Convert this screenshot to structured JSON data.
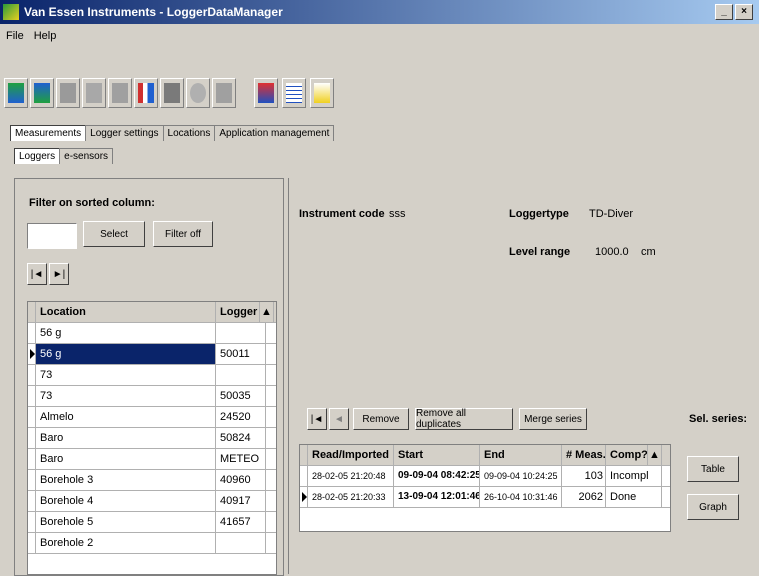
{
  "window": {
    "title": "Van Essen Instruments - LoggerDataManager",
    "min": "_",
    "close": "×"
  },
  "menu": [
    "File",
    "Help"
  ],
  "tabs": [
    "Measurements",
    "Logger settings",
    "Locations",
    "Application management"
  ],
  "subtabs": [
    "Loggers",
    "e-sensors"
  ],
  "filter": {
    "label": "Filter on sorted column:",
    "input_value": "",
    "select": "Select",
    "filter_off": "Filter off",
    "nav_first": "|◄",
    "nav_last": "►|"
  },
  "locations_table": {
    "headers": [
      "Location",
      "Logger"
    ],
    "rows": [
      {
        "location": "56 g",
        "logger": ""
      },
      {
        "location": "56 g",
        "logger": "50011"
      },
      {
        "location": "73",
        "logger": ""
      },
      {
        "location": "73",
        "logger": "50035"
      },
      {
        "location": "Almelo",
        "logger": "24520"
      },
      {
        "location": "Baro",
        "logger": "50824"
      },
      {
        "location": "Baro",
        "logger": "METEO"
      },
      {
        "location": "Borehole 3",
        "logger": "40960"
      },
      {
        "location": "Borehole 4",
        "logger": "40917"
      },
      {
        "location": "Borehole 5",
        "logger": "41657"
      },
      {
        "location": "Borehole 2",
        "logger": ""
      }
    ]
  },
  "info": {
    "instrument_code_label": "Instrument code",
    "instrument_code": "sss",
    "loggertype_label": "Loggertype",
    "loggertype": "TD-Diver",
    "level_range_label": "Level range",
    "level_range": "1000.0",
    "level_unit": "cm"
  },
  "series_bar": {
    "nav_first": "|◄",
    "nav_prev": "◄",
    "remove": "Remove",
    "remove_all": "Remove all duplicates",
    "merge": "Merge series",
    "sel_series": "Sel. series:"
  },
  "series_table": {
    "headers": [
      "Read/Imported",
      "Start",
      "End",
      "# Meas.",
      "Comp?"
    ],
    "rows": [
      {
        "read": "28-02-05 21:20:48",
        "start": "09-09-04 08:42:25",
        "end": "09-09-04 10:24:25",
        "meas": "103",
        "comp": "Incompl"
      },
      {
        "read": "28-02-05 21:20:33",
        "start": "13-09-04 12:01:46",
        "end": "26-10-04 10:31:46",
        "meas": "2062",
        "comp": "Done"
      }
    ]
  },
  "buttons": {
    "table": "Table",
    "graph": "Graph"
  },
  "colors": {
    "window_bg": "#d4d0c8",
    "title_start": "#0a246a",
    "title_end": "#a6caf0",
    "selection": "#0a246a"
  },
  "icons": [
    "download-icon",
    "upload-icon",
    "grid-icon",
    "tools-icon",
    "chart-icon",
    "bars-icon",
    "gray-block-icon",
    "molecule-icon",
    "tools2-icon",
    "home-icon",
    "report-icon",
    "graph-icon"
  ]
}
